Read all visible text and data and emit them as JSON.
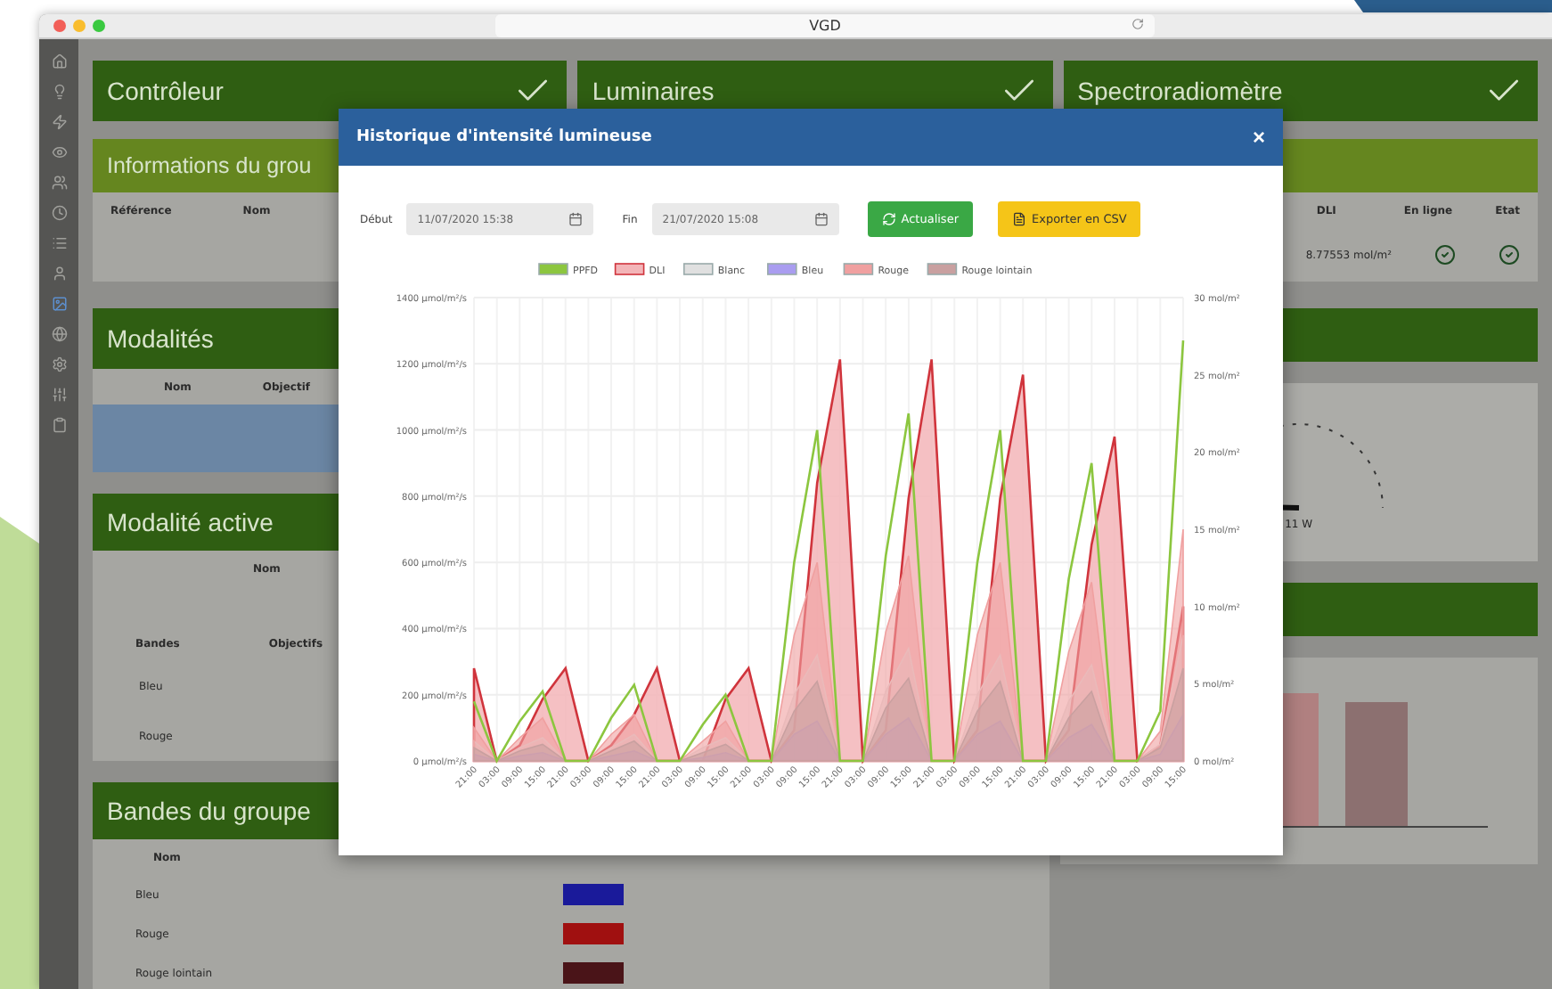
{
  "browser": {
    "title": "VGD"
  },
  "sidebar": {
    "items": [
      {
        "selected": false
      },
      {
        "selected": false
      },
      {
        "selected": false
      },
      {
        "selected": false
      },
      {
        "selected": false
      },
      {
        "selected": false
      },
      {
        "selected": false
      },
      {
        "selected": false
      },
      {
        "selected": true
      },
      {
        "selected": false
      },
      {
        "selected": false
      },
      {
        "selected": false
      },
      {
        "selected": false
      }
    ]
  },
  "status_panels": [
    {
      "title": "Contrôleur",
      "ok": true
    },
    {
      "title": "Luminaires",
      "ok": true
    },
    {
      "title": "Spectroradiomètre",
      "ok": true
    }
  ],
  "group_info": {
    "title": "Informations du grou",
    "columns": [
      "Référence",
      "Nom"
    ],
    "right_columns": [
      "DLI",
      "En ligne",
      "Etat"
    ],
    "right_row": {
      "dli": "8.77553 mol/m²",
      "online": true,
      "state": true
    }
  },
  "modalites": {
    "title": "Modalités",
    "columns": [
      "Nom",
      "Objectif"
    ],
    "rows": [
      {
        "selected": true
      }
    ]
  },
  "modalite_active": {
    "title": "Modalité active",
    "columns": [
      "Nom"
    ],
    "band_columns": [
      "Bandes",
      "Objectifs"
    ],
    "bands": [
      "Bleu",
      "Rouge"
    ]
  },
  "bandes_groupe": {
    "title": "Bandes du groupe",
    "columns": [
      "Nom"
    ],
    "rows": [
      {
        "name": "Bleu",
        "color": "#1a1a9a"
      },
      {
        "name": "Rouge",
        "color": "#a01010"
      },
      {
        "name": "Rouge lointain",
        "color": "#4a1418"
      }
    ]
  },
  "gauge": {
    "reading": "11 W"
  },
  "modal": {
    "title": "Historique d'intensité lumineuse",
    "close": "×",
    "start": {
      "label": "Début",
      "value": "11/07/2020 15:38"
    },
    "end": {
      "label": "Fin",
      "value": "21/07/2020 15:08"
    },
    "buttons": [
      {
        "kind": "refresh",
        "label": "Actualiser"
      },
      {
        "kind": "export",
        "label": "Exporter en CSV"
      }
    ],
    "chart_data": {
      "type": "line",
      "grid": true,
      "legend": "top",
      "categories": [
        "21:00",
        "03:00",
        "09:00",
        "15:00",
        "21:00",
        "03:00",
        "09:00",
        "15:00",
        "21:00",
        "03:00",
        "09:00",
        "15:00",
        "21:00",
        "03:00",
        "09:00",
        "15:00",
        "21:00",
        "03:00",
        "09:00",
        "15:00",
        "21:00",
        "03:00",
        "09:00",
        "15:00",
        "21:00",
        "03:00",
        "09:00",
        "15:00",
        "21:00",
        "03:00",
        "09:00",
        "15:00"
      ],
      "ylim": [
        0,
        1400
      ],
      "yticks": [
        {
          "value": 0,
          "label": "0 µmol/m²/s"
        },
        {
          "value": 200,
          "label": "200 µmol/m²/s"
        },
        {
          "value": 400,
          "label": "400 µmol/m²/s"
        },
        {
          "value": 600,
          "label": "600 µmol/m²/s"
        },
        {
          "value": 800,
          "label": "800 µmol/m²/s"
        },
        {
          "value": 1000,
          "label": "1000 µmol/m²/s"
        },
        {
          "value": 1200,
          "label": "1200 µmol/m²/s"
        },
        {
          "value": 1400,
          "label": "1400 µmol/m²/s"
        }
      ],
      "y2lim": [
        0,
        30
      ],
      "y2ticks": [
        {
          "value": 0,
          "label": "0 mol/m²"
        },
        {
          "value": 5,
          "label": "5 mol/m²"
        },
        {
          "value": 10,
          "label": "10 mol/m²"
        },
        {
          "value": 15,
          "label": "15 mol/m²"
        },
        {
          "value": 20,
          "label": "20 mol/m²"
        },
        {
          "value": 25,
          "label": "25 mol/m²"
        },
        {
          "value": 30,
          "label": "30 mol/m²"
        }
      ],
      "series": [
        {
          "name": "PPFD",
          "color": "#8cc63f",
          "type": "line",
          "values": [
            180,
            0,
            120,
            210,
            0,
            0,
            130,
            230,
            0,
            0,
            110,
            200,
            0,
            0,
            600,
            1000,
            0,
            0,
            620,
            1050,
            0,
            0,
            600,
            1000,
            0,
            0,
            550,
            900,
            0,
            0,
            150,
            1270
          ]
        },
        {
          "name": "DLI",
          "color": "#d0343c",
          "type": "area",
          "axis": "y2",
          "values": [
            6,
            0,
            1,
            4,
            6,
            0,
            1,
            3,
            6,
            0,
            0,
            4,
            6,
            0,
            2,
            18,
            26,
            0,
            2,
            17,
            26,
            0,
            2,
            17,
            25,
            0,
            2,
            14,
            21,
            0,
            1,
            10
          ]
        },
        {
          "name": "Blanc",
          "color": "#e0e0e0",
          "type": "area",
          "values": [
            60,
            0,
            40,
            70,
            0,
            0,
            40,
            80,
            0,
            0,
            40,
            70,
            0,
            0,
            200,
            320,
            0,
            0,
            210,
            340,
            0,
            0,
            200,
            320,
            0,
            0,
            180,
            290,
            0,
            0,
            50,
            380
          ]
        },
        {
          "name": "Bleu",
          "color": "#a99df0",
          "type": "area",
          "values": [
            20,
            0,
            15,
            25,
            0,
            0,
            15,
            30,
            0,
            0,
            10,
            25,
            0,
            0,
            80,
            120,
            0,
            0,
            80,
            130,
            0,
            0,
            80,
            120,
            0,
            0,
            70,
            110,
            0,
            0,
            20,
            140
          ]
        },
        {
          "name": "Rouge",
          "color": "#f0a0a0",
          "type": "area",
          "values": [
            100,
            0,
            70,
            130,
            0,
            0,
            80,
            140,
            0,
            0,
            60,
            120,
            0,
            0,
            380,
            600,
            0,
            0,
            390,
            620,
            0,
            0,
            380,
            600,
            0,
            0,
            330,
            540,
            0,
            0,
            90,
            700
          ]
        },
        {
          "name": "Rouge lointain",
          "color": "#c9a0a0",
          "type": "area",
          "values": [
            40,
            0,
            30,
            50,
            0,
            0,
            30,
            60,
            0,
            0,
            25,
            50,
            0,
            0,
            150,
            240,
            0,
            0,
            160,
            250,
            0,
            0,
            150,
            240,
            0,
            0,
            130,
            210,
            0,
            0,
            40,
            280
          ]
        }
      ]
    }
  }
}
